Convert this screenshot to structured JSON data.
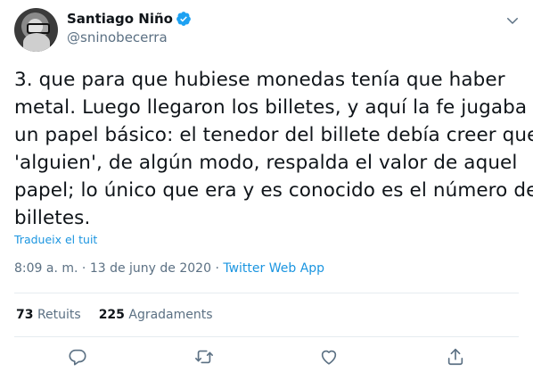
{
  "user": {
    "name": "Santiago Niño",
    "handle": "@sninobecerra"
  },
  "tweet": {
    "lines": [
      "3. que para que hubiese monedas tenía que haber",
      "metal. Luego llegaron los billetes, y aquí la fe jugaba",
      "un papel básico: el tenedor del billete debía creer que",
      "'alguien', de algún modo, respalda el valor de aquel",
      "papel; lo único que era y es conocido es el número de",
      "billetes."
    ],
    "translate_label": "Tradueix el tuit",
    "time": "8:09 a. m.",
    "separator": "·",
    "date": "13 de juny de 2020",
    "app": "Twitter Web App"
  },
  "stats": {
    "retweets_count": "73",
    "retweets_label": "Retuits",
    "likes_count": "225",
    "likes_label": "Agradaments"
  },
  "colors": {
    "link": "#1b95e0",
    "secondary_text": "#5b7083",
    "divider": "#e6ecf0"
  }
}
